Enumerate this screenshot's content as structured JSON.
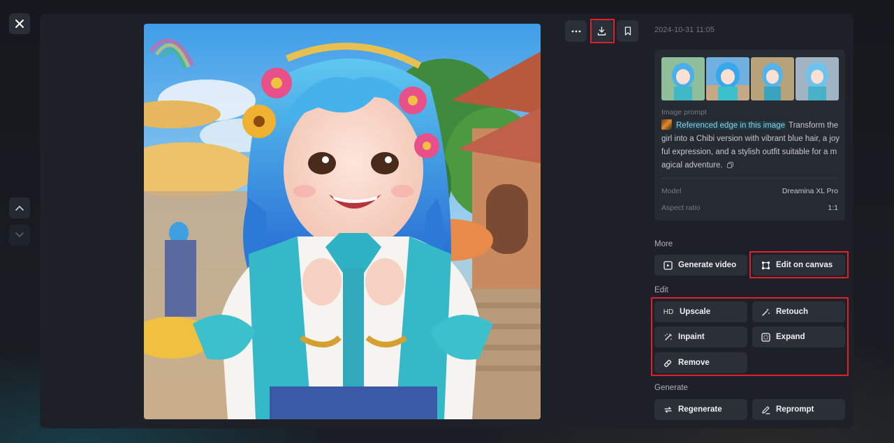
{
  "window": {
    "close_icon": "close-icon",
    "nav_up_icon": "chevron-up-icon",
    "nav_down_icon": "chevron-down-icon"
  },
  "toolbar": {
    "more_icon": "more-horizontal-icon",
    "download_icon": "download-icon",
    "bookmark_icon": "bookmark-icon"
  },
  "details": {
    "timestamp": "2024-10-31 11:05",
    "prompt_label": "Image prompt",
    "reference_label": "Referenced edge in this image",
    "prompt_text": "Transform the girl into a Chibi version with vibrant blue hair, a joyful expression, and a stylish outfit suitable for a magical adventure.",
    "model_label": "Model",
    "model_value": "Dreamina XL Pro",
    "aspect_label": "Aspect ratio",
    "aspect_value": "1:1"
  },
  "sections": {
    "more": "More",
    "edit": "Edit",
    "generate": "Generate"
  },
  "actions": {
    "generate_video": "Generate video",
    "edit_on_canvas": "Edit on canvas",
    "upscale_badge": "HD",
    "upscale": "Upscale",
    "retouch": "Retouch",
    "inpaint": "Inpaint",
    "expand": "Expand",
    "remove": "Remove",
    "regenerate": "Regenerate",
    "reprompt": "Reprompt"
  },
  "colors": {
    "panel": "#1d2127",
    "card": "#262b32",
    "button": "#2b3038",
    "highlight": "#e0202a",
    "ref_link": "#8fd3e6"
  }
}
